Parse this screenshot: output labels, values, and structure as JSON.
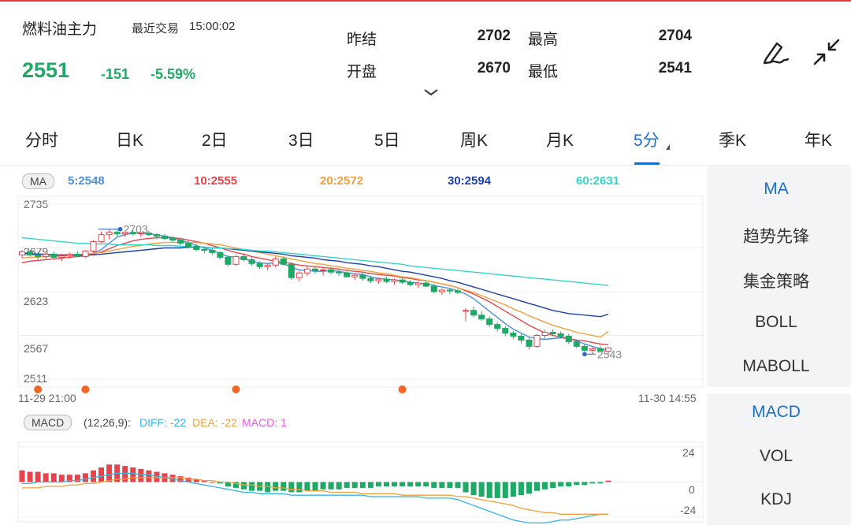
{
  "header": {
    "title": "燃料油主力",
    "latest_trade_label": "最近交易",
    "latest_trade_time": "15:00:02",
    "price": "2551",
    "change": "-151",
    "change_pct": "-5.59%",
    "quotes": {
      "prev_settle_label": "昨结",
      "prev_settle": "2702",
      "high_label": "最高",
      "high": "2704",
      "open_label": "开盘",
      "open": "2670",
      "low_label": "最低",
      "low": "2541"
    }
  },
  "tabs": [
    {
      "label": "分时"
    },
    {
      "label": "日K"
    },
    {
      "label": "2日"
    },
    {
      "label": "3日"
    },
    {
      "label": "5日"
    },
    {
      "label": "周K"
    },
    {
      "label": "月K"
    },
    {
      "label": "5分"
    },
    {
      "label": "季K"
    },
    {
      "label": "年K"
    }
  ],
  "active_tab": "5分",
  "sidebar": {
    "main_indicators": [
      {
        "label": "MA"
      },
      {
        "label": "趋势先锋"
      },
      {
        "label": "集金策略"
      },
      {
        "label": "BOLL"
      },
      {
        "label": "MABOLL"
      }
    ],
    "sub_indicators": [
      {
        "label": "MACD"
      },
      {
        "label": "VOL"
      },
      {
        "label": "KDJ"
      }
    ]
  },
  "ma_legend": {
    "badge": "MA",
    "items": [
      {
        "label": "5:2548",
        "color": "#4a90d9"
      },
      {
        "label": "10:2555",
        "color": "#e8434b"
      },
      {
        "label": "20:2572",
        "color": "#f2a03c"
      },
      {
        "label": "30:2594",
        "color": "#1c3fae"
      },
      {
        "label": "60:2631",
        "color": "#33d6c6"
      }
    ]
  },
  "price_axis": [
    "2735",
    "2679",
    "2623",
    "2567",
    "2511"
  ],
  "time_axis": {
    "start": "11-29 21:00",
    "end": "11-30 14:55"
  },
  "chart_annotations": {
    "max_label": "2703",
    "min_label": "2543"
  },
  "macd_legend": {
    "badge": "MACD",
    "params": "(12,26,9):",
    "diff": "DIFF: -22",
    "dea": "DEA: -22",
    "macd": "MACD: 1",
    "colors": {
      "diff": "#33b5e5",
      "dea": "#f2a03c",
      "macd": "#e75bd6"
    }
  },
  "macd_axis": [
    "24",
    "0",
    "-24"
  ],
  "colors": {
    "up": "#e8434b",
    "down": "#1fa866",
    "accent": "#1b6fc8",
    "marker": "#f26522"
  },
  "chart_data": {
    "type": "candlestick",
    "interval": "5分",
    "ylim": [
      2511,
      2735
    ],
    "candles": [
      [
        2670,
        2676,
        2666,
        2674
      ],
      [
        2674,
        2676,
        2668,
        2670
      ],
      [
        2670,
        2674,
        2664,
        2668
      ],
      [
        2668,
        2672,
        2665,
        2671
      ],
      [
        2671,
        2674,
        2666,
        2667
      ],
      [
        2667,
        2672,
        2662,
        2669
      ],
      [
        2669,
        2673,
        2666,
        2671
      ],
      [
        2671,
        2675,
        2667,
        2668
      ],
      [
        2668,
        2676,
        2666,
        2675
      ],
      [
        2675,
        2689,
        2673,
        2687
      ],
      [
        2687,
        2700,
        2685,
        2696
      ],
      [
        2696,
        2703,
        2690,
        2699
      ],
      [
        2699,
        2702,
        2694,
        2697
      ],
      [
        2697,
        2700,
        2693,
        2699
      ],
      [
        2699,
        2702,
        2695,
        2697
      ],
      [
        2697,
        2699,
        2693,
        2698
      ],
      [
        2698,
        2701,
        2694,
        2696
      ],
      [
        2696,
        2698,
        2690,
        2694
      ],
      [
        2694,
        2697,
        2689,
        2691
      ],
      [
        2691,
        2694,
        2686,
        2689
      ],
      [
        2689,
        2692,
        2682,
        2685
      ],
      [
        2685,
        2688,
        2678,
        2681
      ],
      [
        2681,
        2684,
        2675,
        2677
      ],
      [
        2677,
        2680,
        2672,
        2676
      ],
      [
        2676,
        2679,
        2670,
        2673
      ],
      [
        2673,
        2675,
        2664,
        2667
      ],
      [
        2667,
        2669,
        2655,
        2658
      ],
      [
        2658,
        2670,
        2656,
        2668
      ],
      [
        2668,
        2672,
        2662,
        2664
      ],
      [
        2664,
        2667,
        2656,
        2659
      ],
      [
        2659,
        2662,
        2652,
        2655
      ],
      [
        2655,
        2659,
        2650,
        2657
      ],
      [
        2657,
        2668,
        2654,
        2665
      ],
      [
        2665,
        2668,
        2656,
        2658
      ],
      [
        2658,
        2661,
        2638,
        2641
      ],
      [
        2641,
        2650,
        2636,
        2647
      ],
      [
        2647,
        2655,
        2643,
        2652
      ],
      [
        2652,
        2656,
        2646,
        2650
      ],
      [
        2650,
        2654,
        2644,
        2651
      ],
      [
        2651,
        2654,
        2645,
        2648
      ],
      [
        2648,
        2651,
        2643,
        2647
      ],
      [
        2647,
        2649,
        2641,
        2642
      ],
      [
        2642,
        2646,
        2638,
        2644
      ],
      [
        2644,
        2647,
        2637,
        2640
      ],
      [
        2640,
        2643,
        2634,
        2637
      ],
      [
        2637,
        2641,
        2633,
        2639
      ],
      [
        2639,
        2642,
        2634,
        2636
      ],
      [
        2636,
        2640,
        2632,
        2638
      ],
      [
        2638,
        2641,
        2633,
        2635
      ],
      [
        2635,
        2638,
        2630,
        2632
      ],
      [
        2632,
        2636,
        2628,
        2634
      ],
      [
        2634,
        2637,
        2629,
        2630
      ],
      [
        2630,
        2633,
        2621,
        2623
      ],
      [
        2623,
        2627,
        2619,
        2625
      ],
      [
        2625,
        2628,
        2620,
        2624
      ],
      [
        2624,
        2627,
        2620,
        2622
      ],
      [
        2598,
        2602,
        2585,
        2599
      ],
      [
        2599,
        2604,
        2590,
        2593
      ],
      [
        2593,
        2598,
        2586,
        2588
      ],
      [
        2588,
        2591,
        2578,
        2581
      ],
      [
        2581,
        2584,
        2572,
        2576
      ],
      [
        2576,
        2579,
        2566,
        2570
      ],
      [
        2570,
        2573,
        2562,
        2566
      ],
      [
        2566,
        2569,
        2557,
        2561
      ],
      [
        2561,
        2564,
        2549,
        2553
      ],
      [
        2553,
        2569,
        2551,
        2567
      ],
      [
        2567,
        2574,
        2563,
        2571
      ],
      [
        2571,
        2575,
        2566,
        2569
      ],
      [
        2569,
        2572,
        2563,
        2566
      ],
      [
        2566,
        2569,
        2556,
        2559
      ],
      [
        2559,
        2562,
        2551,
        2553
      ],
      [
        2553,
        2556,
        2545,
        2548
      ],
      [
        2548,
        2552,
        2543,
        2550
      ],
      [
        2550,
        2553,
        2545,
        2547
      ],
      [
        2547,
        2552,
        2543,
        2551
      ]
    ],
    "ma": {
      "ma5": [
        2672,
        2672,
        2671,
        2670,
        2670,
        2669,
        2669,
        2669,
        2670,
        2672,
        2677,
        2685,
        2693,
        2696,
        2698,
        2698,
        2697,
        2696,
        2694,
        2692,
        2689,
        2686,
        2682,
        2679,
        2676,
        2672,
        2668,
        2667,
        2665,
        2662,
        2660,
        2659,
        2660,
        2659,
        2654,
        2651,
        2650,
        2649,
        2649,
        2650,
        2649,
        2647,
        2646,
        2645,
        2642,
        2640,
        2639,
        2638,
        2637,
        2635,
        2634,
        2633,
        2631,
        2629,
        2627,
        2624,
        2620,
        2614,
        2606,
        2598,
        2590,
        2582,
        2575,
        2570,
        2565,
        2563,
        2562,
        2563,
        2564,
        2563,
        2560,
        2556,
        2553,
        2550,
        2548
      ],
      "ma10": [
        2660,
        2662,
        2663,
        2664,
        2665,
        2666,
        2667,
        2668,
        2669,
        2671,
        2674,
        2678,
        2682,
        2685,
        2688,
        2690,
        2691,
        2692,
        2692,
        2692,
        2691,
        2689,
        2687,
        2685,
        2682,
        2679,
        2676,
        2673,
        2671,
        2668,
        2666,
        2664,
        2662,
        2661,
        2659,
        2657,
        2656,
        2655,
        2654,
        2653,
        2652,
        2650,
        2649,
        2648,
        2646,
        2645,
        2644,
        2643,
        2641,
        2640,
        2638,
        2637,
        2635,
        2633,
        2631,
        2628,
        2624,
        2620,
        2615,
        2610,
        2604,
        2598,
        2592,
        2586,
        2580,
        2575,
        2570,
        2567,
        2565,
        2563,
        2561,
        2560,
        2558,
        2556,
        2555
      ],
      "ma20": [
        2666,
        2667,
        2667,
        2668,
        2668,
        2669,
        2669,
        2670,
        2671,
        2672,
        2673,
        2675,
        2677,
        2679,
        2681,
        2682,
        2684,
        2685,
        2686,
        2686,
        2686,
        2686,
        2686,
        2685,
        2684,
        2683,
        2681,
        2679,
        2677,
        2675,
        2673,
        2671,
        2669,
        2667,
        2665,
        2663,
        2661,
        2659,
        2658,
        2656,
        2655,
        2653,
        2652,
        2650,
        2649,
        2647,
        2646,
        2644,
        2642,
        2641,
        2639,
        2637,
        2635,
        2633,
        2631,
        2628,
        2625,
        2622,
        2618,
        2614,
        2610,
        2606,
        2601,
        2597,
        2592,
        2588,
        2584,
        2580,
        2577,
        2574,
        2571,
        2569,
        2567,
        2565,
        2572
      ],
      "ma30": [
        2672,
        2672,
        2671,
        2671,
        2670,
        2670,
        2670,
        2670,
        2670,
        2670,
        2671,
        2672,
        2673,
        2674,
        2675,
        2676,
        2677,
        2678,
        2679,
        2679,
        2679,
        2680,
        2680,
        2680,
        2679,
        2679,
        2678,
        2677,
        2676,
        2675,
        2674,
        2673,
        2672,
        2671,
        2669,
        2668,
        2667,
        2666,
        2664,
        2663,
        2662,
        2660,
        2659,
        2658,
        2656,
        2655,
        2653,
        2651,
        2649,
        2648,
        2646,
        2644,
        2642,
        2640,
        2637,
        2635,
        2632,
        2629,
        2626,
        2623,
        2620,
        2617,
        2614,
        2611,
        2608,
        2605,
        2602,
        2599,
        2597,
        2595,
        2594,
        2593,
        2592,
        2591,
        2594
      ],
      "ma60": [
        2692,
        2691,
        2690,
        2689,
        2688,
        2687,
        2686,
        2685,
        2685,
        2684,
        2684,
        2684,
        2683,
        2683,
        2683,
        2683,
        2683,
        2682,
        2682,
        2682,
        2681,
        2681,
        2680,
        2680,
        2679,
        2679,
        2678,
        2678,
        2677,
        2676,
        2675,
        2675,
        2674,
        2673,
        2672,
        2671,
        2670,
        2669,
        2668,
        2667,
        2666,
        2665,
        2664,
        2663,
        2662,
        2661,
        2660,
        2659,
        2658,
        2656,
        2655,
        2654,
        2653,
        2652,
        2651,
        2650,
        2649,
        2648,
        2647,
        2646,
        2645,
        2644,
        2643,
        2642,
        2641,
        2640,
        2639,
        2638,
        2637,
        2636,
        2635,
        2634,
        2633,
        2632,
        2631
      ]
    },
    "event_markers": [
      2,
      8,
      27,
      48
    ],
    "macd": {
      "ylim": [
        -24,
        24
      ],
      "hist": [
        8,
        7,
        7,
        6,
        6,
        5,
        5,
        5,
        6,
        8,
        10,
        12,
        12,
        11,
        10,
        9,
        8,
        7,
        6,
        5,
        4,
        3,
        2,
        1,
        0,
        -1,
        -3,
        -4,
        -5,
        -6,
        -6,
        -7,
        -6,
        -6,
        -7,
        -7,
        -6,
        -6,
        -5,
        -5,
        -5,
        -4,
        -4,
        -4,
        -4,
        -3,
        -3,
        -3,
        -3,
        -3,
        -3,
        -3,
        -4,
        -4,
        -4,
        -4,
        -7,
        -9,
        -10,
        -11,
        -11,
        -11,
        -10,
        -9,
        -8,
        -6,
        -5,
        -4,
        -3,
        -3,
        -2,
        -2,
        -1,
        -1,
        1
      ],
      "diff": [
        -1,
        -1,
        0,
        0,
        0,
        0,
        1,
        1,
        2,
        3,
        4,
        5,
        6,
        6,
        6,
        5,
        5,
        4,
        3,
        2,
        1,
        0,
        -1,
        -2,
        -3,
        -4,
        -5,
        -6,
        -7,
        -7,
        -8,
        -8,
        -8,
        -8,
        -9,
        -9,
        -9,
        -9,
        -9,
        -9,
        -9,
        -9,
        -9,
        -9,
        -10,
        -10,
        -10,
        -10,
        -10,
        -10,
        -10,
        -11,
        -11,
        -11,
        -11,
        -12,
        -14,
        -16,
        -18,
        -20,
        -22,
        -24,
        -26,
        -27,
        -28,
        -28,
        -28,
        -27,
        -26,
        -26,
        -25,
        -24,
        -23,
        -22,
        -22
      ],
      "dea": [
        -4,
        -4,
        -4,
        -3,
        -3,
        -3,
        -2,
        -2,
        -1,
        -1,
        0,
        1,
        2,
        2,
        3,
        3,
        3,
        3,
        3,
        3,
        3,
        2,
        2,
        1,
        1,
        0,
        0,
        -1,
        -2,
        -2,
        -3,
        -3,
        -4,
        -4,
        -5,
        -5,
        -6,
        -6,
        -6,
        -7,
        -7,
        -7,
        -7,
        -8,
        -8,
        -8,
        -8,
        -8,
        -9,
        -9,
        -9,
        -9,
        -9,
        -9,
        -9,
        -10,
        -10,
        -11,
        -12,
        -13,
        -14,
        -15,
        -16,
        -18,
        -19,
        -20,
        -21,
        -21,
        -22,
        -22,
        -22,
        -22,
        -22,
        -22,
        -22
      ]
    }
  }
}
